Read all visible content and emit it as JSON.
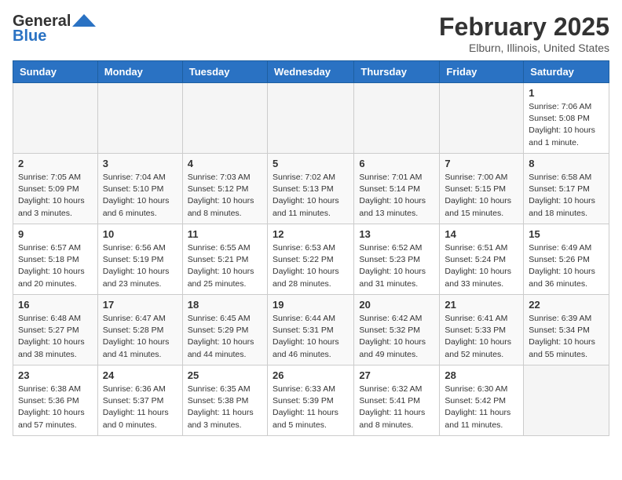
{
  "header": {
    "logo_general": "General",
    "logo_blue": "Blue",
    "title": "February 2025",
    "subtitle": "Elburn, Illinois, United States"
  },
  "weekdays": [
    "Sunday",
    "Monday",
    "Tuesday",
    "Wednesday",
    "Thursday",
    "Friday",
    "Saturday"
  ],
  "weeks": [
    [
      {
        "day": "",
        "info": "",
        "empty": true
      },
      {
        "day": "",
        "info": "",
        "empty": true
      },
      {
        "day": "",
        "info": "",
        "empty": true
      },
      {
        "day": "",
        "info": "",
        "empty": true
      },
      {
        "day": "",
        "info": "",
        "empty": true
      },
      {
        "day": "",
        "info": "",
        "empty": true
      },
      {
        "day": "1",
        "info": "Sunrise: 7:06 AM\nSunset: 5:08 PM\nDaylight: 10 hours\nand 1 minute."
      }
    ],
    [
      {
        "day": "2",
        "info": "Sunrise: 7:05 AM\nSunset: 5:09 PM\nDaylight: 10 hours\nand 3 minutes."
      },
      {
        "day": "3",
        "info": "Sunrise: 7:04 AM\nSunset: 5:10 PM\nDaylight: 10 hours\nand 6 minutes."
      },
      {
        "day": "4",
        "info": "Sunrise: 7:03 AM\nSunset: 5:12 PM\nDaylight: 10 hours\nand 8 minutes."
      },
      {
        "day": "5",
        "info": "Sunrise: 7:02 AM\nSunset: 5:13 PM\nDaylight: 10 hours\nand 11 minutes."
      },
      {
        "day": "6",
        "info": "Sunrise: 7:01 AM\nSunset: 5:14 PM\nDaylight: 10 hours\nand 13 minutes."
      },
      {
        "day": "7",
        "info": "Sunrise: 7:00 AM\nSunset: 5:15 PM\nDaylight: 10 hours\nand 15 minutes."
      },
      {
        "day": "8",
        "info": "Sunrise: 6:58 AM\nSunset: 5:17 PM\nDaylight: 10 hours\nand 18 minutes."
      }
    ],
    [
      {
        "day": "9",
        "info": "Sunrise: 6:57 AM\nSunset: 5:18 PM\nDaylight: 10 hours\nand 20 minutes."
      },
      {
        "day": "10",
        "info": "Sunrise: 6:56 AM\nSunset: 5:19 PM\nDaylight: 10 hours\nand 23 minutes."
      },
      {
        "day": "11",
        "info": "Sunrise: 6:55 AM\nSunset: 5:21 PM\nDaylight: 10 hours\nand 25 minutes."
      },
      {
        "day": "12",
        "info": "Sunrise: 6:53 AM\nSunset: 5:22 PM\nDaylight: 10 hours\nand 28 minutes."
      },
      {
        "day": "13",
        "info": "Sunrise: 6:52 AM\nSunset: 5:23 PM\nDaylight: 10 hours\nand 31 minutes."
      },
      {
        "day": "14",
        "info": "Sunrise: 6:51 AM\nSunset: 5:24 PM\nDaylight: 10 hours\nand 33 minutes."
      },
      {
        "day": "15",
        "info": "Sunrise: 6:49 AM\nSunset: 5:26 PM\nDaylight: 10 hours\nand 36 minutes."
      }
    ],
    [
      {
        "day": "16",
        "info": "Sunrise: 6:48 AM\nSunset: 5:27 PM\nDaylight: 10 hours\nand 38 minutes."
      },
      {
        "day": "17",
        "info": "Sunrise: 6:47 AM\nSunset: 5:28 PM\nDaylight: 10 hours\nand 41 minutes."
      },
      {
        "day": "18",
        "info": "Sunrise: 6:45 AM\nSunset: 5:29 PM\nDaylight: 10 hours\nand 44 minutes."
      },
      {
        "day": "19",
        "info": "Sunrise: 6:44 AM\nSunset: 5:31 PM\nDaylight: 10 hours\nand 46 minutes."
      },
      {
        "day": "20",
        "info": "Sunrise: 6:42 AM\nSunset: 5:32 PM\nDaylight: 10 hours\nand 49 minutes."
      },
      {
        "day": "21",
        "info": "Sunrise: 6:41 AM\nSunset: 5:33 PM\nDaylight: 10 hours\nand 52 minutes."
      },
      {
        "day": "22",
        "info": "Sunrise: 6:39 AM\nSunset: 5:34 PM\nDaylight: 10 hours\nand 55 minutes."
      }
    ],
    [
      {
        "day": "23",
        "info": "Sunrise: 6:38 AM\nSunset: 5:36 PM\nDaylight: 10 hours\nand 57 minutes."
      },
      {
        "day": "24",
        "info": "Sunrise: 6:36 AM\nSunset: 5:37 PM\nDaylight: 11 hours\nand 0 minutes."
      },
      {
        "day": "25",
        "info": "Sunrise: 6:35 AM\nSunset: 5:38 PM\nDaylight: 11 hours\nand 3 minutes."
      },
      {
        "day": "26",
        "info": "Sunrise: 6:33 AM\nSunset: 5:39 PM\nDaylight: 11 hours\nand 5 minutes."
      },
      {
        "day": "27",
        "info": "Sunrise: 6:32 AM\nSunset: 5:41 PM\nDaylight: 11 hours\nand 8 minutes."
      },
      {
        "day": "28",
        "info": "Sunrise: 6:30 AM\nSunset: 5:42 PM\nDaylight: 11 hours\nand 11 minutes."
      },
      {
        "day": "",
        "info": "",
        "empty": true
      }
    ]
  ]
}
